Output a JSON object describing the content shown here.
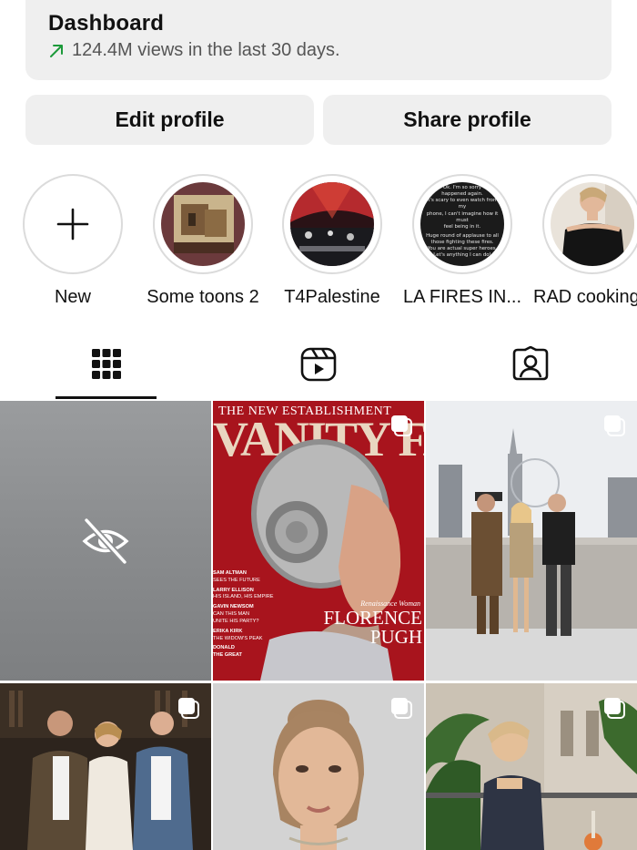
{
  "dashboard": {
    "title": "Dashboard",
    "subtitle": "124.4M views in the last 30 days.",
    "trend_icon": "arrow-up-right-icon",
    "trend_color": "#1c9a3a"
  },
  "buttons": {
    "edit": "Edit profile",
    "share": "Share profile"
  },
  "highlights": [
    {
      "label": "New",
      "icon": "plus-icon"
    },
    {
      "label": "Some toons 2"
    },
    {
      "label": "T4Palestine"
    },
    {
      "label": "LA FIRES IN..."
    },
    {
      "label": "RAD cooking"
    }
  ],
  "highlight_story_text": {
    "line1": "Ok. I'm so sorry",
    "line2": "happened again.",
    "line3": "It's scary to even watch from my",
    "line4": "phone, I can't imagine how it must",
    "line5": "feel being in it.",
    "line6": "Huge round of applause to all",
    "line7": "those fighting these fires.",
    "line8": "You are actual super heroes.",
    "line9": "Let's anything I can do!"
  },
  "tabs": [
    {
      "name": "posts",
      "icon": "grid-icon",
      "active": true
    },
    {
      "name": "reels",
      "icon": "reels-icon",
      "active": false
    },
    {
      "name": "tagged",
      "icon": "tagged-person-icon",
      "active": false
    }
  ],
  "posts": [
    {
      "type": "hidden",
      "icon": "eye-off-icon"
    },
    {
      "type": "magazine",
      "multi": true,
      "banner": "THE NEW ESTABLISHMENT",
      "masthead": "VANITY FAIR",
      "headlines": [
        "SAM ALTMAN",
        "SEES THE FUTURE",
        "LARRY ELLISON",
        "HIS ISLAND, HIS EMPIRE",
        "GAVIN NEWSOM",
        "CAN THIS MAN",
        "UNITE HIS PARTY?",
        "ERIKA KIRK",
        "THE WIDOW'S PEAK",
        "DONALD",
        "THE GREAT"
      ],
      "cover_tag": "Renaissance Woman",
      "cover_name_1": "FLORENCE",
      "cover_name_2": "PUGH"
    },
    {
      "type": "photo",
      "multi": true,
      "scene": "rooftop"
    },
    {
      "type": "photo",
      "multi": true,
      "scene": "library"
    },
    {
      "type": "photo",
      "multi": true,
      "scene": "portrait"
    },
    {
      "type": "photo",
      "multi": true,
      "scene": "terrace"
    }
  ]
}
